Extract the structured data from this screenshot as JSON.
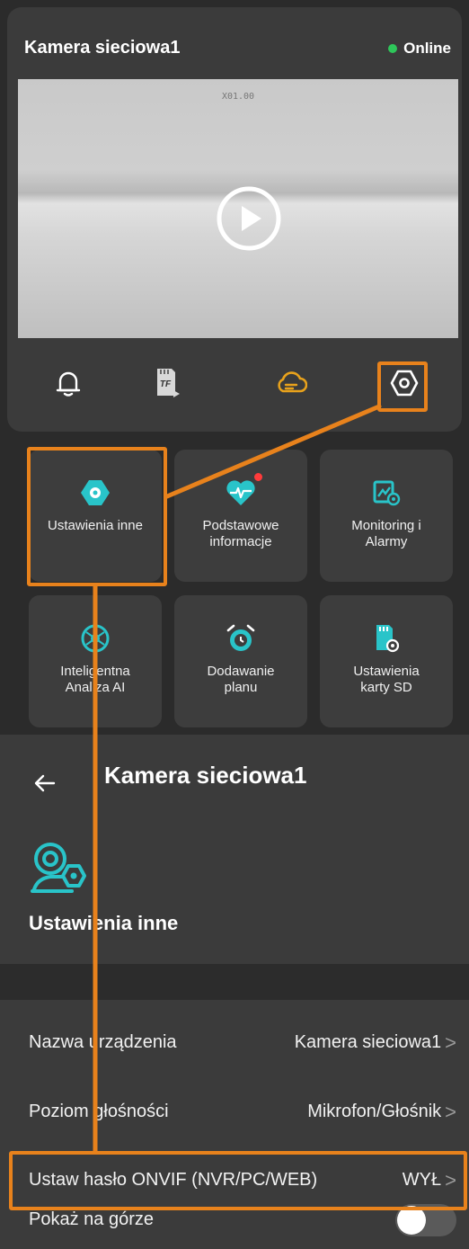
{
  "camera": {
    "title": "Kamera sieciowa1",
    "status": "Online",
    "video_caption": "X01.00",
    "actions": [
      {
        "name": "bell-icon"
      },
      {
        "name": "tf-card-icon",
        "badge": "TF"
      },
      {
        "name": "cloud-icon"
      },
      {
        "name": "settings-hex-icon"
      }
    ]
  },
  "tiles": [
    {
      "label": "Ustawienia inne"
    },
    {
      "label": "Podstawowe\ninformacje"
    },
    {
      "label": "Monitoring i\nAlarmy"
    },
    {
      "label": "Inteligentna\nAnaliza AI"
    },
    {
      "label": "Dodawanie\nplanu"
    },
    {
      "label": "Ustawienia\nkarty SD"
    }
  ],
  "panel": {
    "title": "Kamera sieciowa1",
    "section": "Ustawienia inne",
    "rows": [
      {
        "label": "Nazwa urządzenia",
        "value": "Kamera sieciowa1"
      },
      {
        "label": "Poziom głośności",
        "value": "Mikrofon/Głośnik"
      },
      {
        "label": "Ustaw hasło ONVIF (NVR/PC/WEB)",
        "value": "WYŁ"
      },
      {
        "label": "Pokaż na górze",
        "toggle": false
      }
    ],
    "chevron": ">"
  },
  "colors": {
    "accent": "#e8821c",
    "teal": "#29c4c9",
    "online": "#2ec65a",
    "cloud": "#e8a21c"
  }
}
